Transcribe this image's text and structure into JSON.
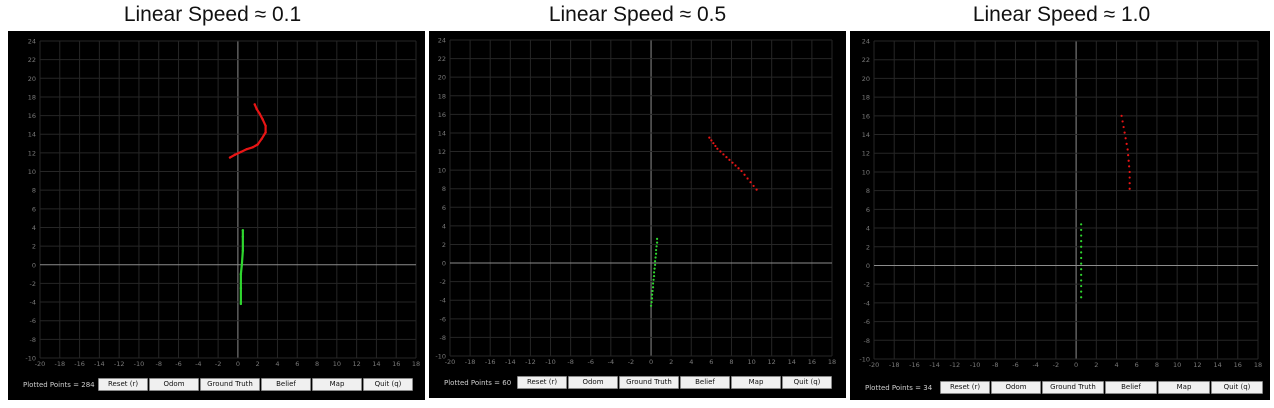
{
  "colors": {
    "background": "#000000",
    "grid": "#262626",
    "axis": "#8c8c8c",
    "tick_text": "#7a7a7a",
    "ground_truth": "#e81515",
    "odom": "#2fd62f"
  },
  "buttons": [
    "Reset (r)",
    "Odom",
    "Ground Truth",
    "Belief",
    "Map",
    "Quit (q)"
  ],
  "panels": [
    {
      "title": "Linear Speed ≈ 0.1",
      "plotted_points_label": "Plotted Points = 284",
      "chart_data": {
        "type": "scatter",
        "xlim": [
          -20,
          18
        ],
        "ylim": [
          -10,
          24
        ],
        "x_ticks": [
          -20,
          -18,
          -16,
          -14,
          -12,
          -10,
          -8,
          -6,
          -4,
          -2,
          0,
          2,
          4,
          6,
          8,
          10,
          12,
          14,
          16,
          18
        ],
        "y_ticks": [
          -10,
          -8,
          -6,
          -4,
          -2,
          0,
          2,
          4,
          6,
          8,
          10,
          12,
          14,
          16,
          18,
          20,
          22,
          24
        ],
        "grid": true,
        "series": [
          {
            "color": "#e81515",
            "style": "dense",
            "points": [
              [
                -0.8,
                11.5
              ],
              [
                -0.3,
                11.8
              ],
              [
                0.3,
                12.1
              ],
              [
                0.9,
                12.4
              ],
              [
                1.5,
                12.6
              ],
              [
                2.0,
                12.9
              ],
              [
                2.4,
                13.5
              ],
              [
                2.8,
                14.2
              ],
              [
                2.8,
                14.9
              ],
              [
                2.5,
                15.6
              ],
              [
                2.2,
                16.2
              ],
              [
                1.9,
                16.7
              ],
              [
                1.7,
                17.2
              ]
            ]
          },
          {
            "color": "#2fd62f",
            "style": "dense",
            "points": [
              [
                0.3,
                -4.2
              ],
              [
                0.3,
                -2.5
              ],
              [
                0.3,
                -1.0
              ],
              [
                0.4,
                0.0
              ],
              [
                0.5,
                1.5
              ],
              [
                0.5,
                3.0
              ],
              [
                0.5,
                3.7
              ]
            ]
          }
        ]
      }
    },
    {
      "title": "Linear Speed ≈ 0.5",
      "plotted_points_label": "Plotted Points = 60",
      "chart_data": {
        "type": "scatter",
        "xlim": [
          -20,
          18
        ],
        "ylim": [
          -10,
          24
        ],
        "x_ticks": [
          -20,
          -18,
          -16,
          -14,
          -12,
          -10,
          -8,
          -6,
          -4,
          -2,
          0,
          2,
          4,
          6,
          8,
          10,
          12,
          14,
          16,
          18
        ],
        "y_ticks": [
          -10,
          -8,
          -6,
          -4,
          -2,
          0,
          2,
          4,
          6,
          8,
          10,
          12,
          14,
          16,
          18,
          20,
          22,
          24
        ],
        "grid": true,
        "series": [
          {
            "color": "#e81515",
            "style": "sparse",
            "points": [
              [
                5.8,
                13.5
              ],
              [
                6.0,
                13.2
              ],
              [
                6.2,
                12.9
              ],
              [
                6.4,
                12.6
              ],
              [
                6.6,
                12.3
              ],
              [
                6.9,
                12.0
              ],
              [
                7.2,
                11.7
              ],
              [
                7.5,
                11.4
              ],
              [
                7.8,
                11.1
              ],
              [
                8.1,
                10.8
              ],
              [
                8.4,
                10.5
              ],
              [
                8.7,
                10.2
              ],
              [
                9.0,
                9.9
              ],
              [
                9.3,
                9.5
              ],
              [
                9.6,
                9.1
              ],
              [
                9.9,
                8.7
              ],
              [
                10.2,
                8.3
              ],
              [
                10.5,
                7.9
              ]
            ]
          },
          {
            "color": "#2fd62f",
            "style": "sparse",
            "points": [
              [
                0.0,
                -4.6
              ],
              [
                0.05,
                -4.2
              ],
              [
                0.1,
                -3.8
              ],
              [
                0.1,
                -3.4
              ],
              [
                0.15,
                -3.0
              ],
              [
                0.2,
                -2.6
              ],
              [
                0.2,
                -2.2
              ],
              [
                0.25,
                -1.8
              ],
              [
                0.3,
                -1.4
              ],
              [
                0.3,
                -1.0
              ],
              [
                0.35,
                -0.6
              ],
              [
                0.4,
                -0.2
              ],
              [
                0.4,
                0.2
              ],
              [
                0.45,
                0.6
              ],
              [
                0.5,
                1.0
              ],
              [
                0.5,
                1.4
              ],
              [
                0.55,
                1.8
              ],
              [
                0.6,
                2.2
              ],
              [
                0.6,
                2.6
              ]
            ]
          }
        ]
      }
    },
    {
      "title": "Linear Speed ≈ 1.0",
      "plotted_points_label": "Plotted Points = 34",
      "chart_data": {
        "type": "scatter",
        "xlim": [
          -20,
          18
        ],
        "ylim": [
          -10,
          24
        ],
        "x_ticks": [
          -20,
          -18,
          -16,
          -14,
          -12,
          -10,
          -8,
          -6,
          -4,
          -2,
          0,
          2,
          4,
          6,
          8,
          10,
          12,
          14,
          16,
          18
        ],
        "y_ticks": [
          -10,
          -8,
          -6,
          -4,
          -2,
          0,
          2,
          4,
          6,
          8,
          10,
          12,
          14,
          16,
          18,
          20,
          22,
          24
        ],
        "grid": true,
        "series": [
          {
            "color": "#e81515",
            "style": "sparse",
            "points": [
              [
                4.5,
                16.0
              ],
              [
                4.6,
                15.4
              ],
              [
                4.7,
                14.8
              ],
              [
                4.8,
                14.2
              ],
              [
                4.9,
                13.6
              ],
              [
                5.0,
                13.0
              ],
              [
                5.1,
                12.4
              ],
              [
                5.15,
                11.8
              ],
              [
                5.2,
                11.2
              ],
              [
                5.25,
                10.6
              ],
              [
                5.3,
                10.0
              ],
              [
                5.3,
                9.4
              ],
              [
                5.3,
                8.8
              ],
              [
                5.3,
                8.2
              ]
            ]
          },
          {
            "color": "#2fd62f",
            "style": "sparse",
            "points": [
              [
                0.5,
                -3.4
              ],
              [
                0.5,
                -2.8
              ],
              [
                0.5,
                -2.2
              ],
              [
                0.5,
                -1.6
              ],
              [
                0.5,
                -1.0
              ],
              [
                0.5,
                -0.4
              ],
              [
                0.5,
                0.2
              ],
              [
                0.5,
                0.8
              ],
              [
                0.5,
                1.4
              ],
              [
                0.5,
                2.0
              ],
              [
                0.5,
                2.6
              ],
              [
                0.5,
                3.2
              ],
              [
                0.5,
                3.8
              ],
              [
                0.5,
                4.4
              ]
            ]
          }
        ]
      }
    }
  ]
}
